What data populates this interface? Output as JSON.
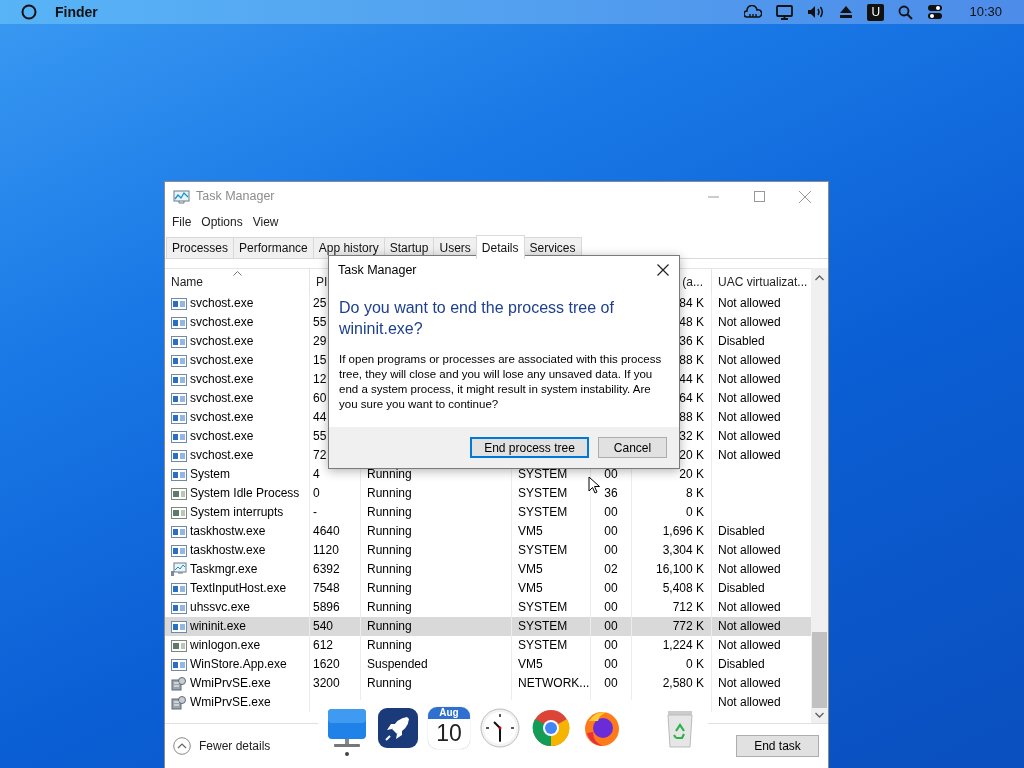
{
  "menubar": {
    "app_name": "Finder",
    "badge_letter": "U",
    "time": "10:30"
  },
  "window": {
    "title": "Task Manager",
    "menu": [
      "File",
      "Options",
      "View"
    ],
    "tabs": [
      {
        "label": "Processes",
        "selected": false
      },
      {
        "label": "Performance",
        "selected": false
      },
      {
        "label": "App history",
        "selected": false
      },
      {
        "label": "Startup",
        "selected": false
      },
      {
        "label": "Users",
        "selected": false
      },
      {
        "label": "Details",
        "selected": true
      },
      {
        "label": "Services",
        "selected": false
      }
    ],
    "table": {
      "columns": {
        "name": "Name",
        "pid": "PI",
        "memory": "(a...",
        "uac": "UAC virtualizat..."
      },
      "rows": [
        {
          "kind": "service",
          "name": "svchost.exe",
          "pid": "25",
          "memory": "84 K",
          "uac": "Not allowed",
          "selected": false
        },
        {
          "kind": "service",
          "name": "svchost.exe",
          "pid": "55",
          "memory": "48 K",
          "uac": "Not allowed",
          "selected": false
        },
        {
          "kind": "service",
          "name": "svchost.exe",
          "pid": "29",
          "memory": "36 K",
          "uac": "Disabled",
          "selected": false
        },
        {
          "kind": "service",
          "name": "svchost.exe",
          "pid": "15",
          "memory": "88 K",
          "uac": "Not allowed",
          "selected": false
        },
        {
          "kind": "service",
          "name": "svchost.exe",
          "pid": "12",
          "memory": "44 K",
          "uac": "Not allowed",
          "selected": false
        },
        {
          "kind": "service",
          "name": "svchost.exe",
          "pid": "60",
          "memory": "64 K",
          "uac": "Not allowed",
          "selected": false
        },
        {
          "kind": "service",
          "name": "svchost.exe",
          "pid": "44",
          "memory": "88 K",
          "uac": "Not allowed",
          "selected": false
        },
        {
          "kind": "service",
          "name": "svchost.exe",
          "pid": "55",
          "memory": "32 K",
          "uac": "Not allowed",
          "selected": false
        },
        {
          "kind": "service",
          "name": "svchost.exe",
          "pid": "72",
          "memory": "20 K",
          "uac": "Not allowed",
          "selected": false
        },
        {
          "kind": "service",
          "name": "System",
          "pid": "4",
          "status": "Running",
          "user": "SYSTEM",
          "cpu": "00",
          "memory": "20 K",
          "selected": false
        },
        {
          "kind": "system",
          "name": "System Idle Process",
          "pid": "0",
          "status": "Running",
          "user": "SYSTEM",
          "cpu": "36",
          "memory": "8 K",
          "selected": false
        },
        {
          "kind": "system",
          "name": "System interrupts",
          "pid": "-",
          "status": "Running",
          "user": "SYSTEM",
          "cpu": "00",
          "memory": "0 K",
          "selected": false
        },
        {
          "kind": "service",
          "name": "taskhostw.exe",
          "pid": "4640",
          "status": "Running",
          "user": "VM5",
          "cpu": "00",
          "memory": "1,696 K",
          "uac": "Disabled",
          "selected": false
        },
        {
          "kind": "service",
          "name": "taskhostw.exe",
          "pid": "1120",
          "status": "Running",
          "user": "SYSTEM",
          "cpu": "00",
          "memory": "3,304 K",
          "uac": "Not allowed",
          "selected": false
        },
        {
          "kind": "taskmgr",
          "name": "Taskmgr.exe",
          "pid": "6392",
          "status": "Running",
          "user": "VM5",
          "cpu": "02",
          "memory": "16,100 K",
          "uac": "Not allowed",
          "selected": false
        },
        {
          "kind": "service",
          "name": "TextInputHost.exe",
          "pid": "7548",
          "status": "Running",
          "user": "VM5",
          "cpu": "00",
          "memory": "5,408 K",
          "uac": "Disabled",
          "selected": false
        },
        {
          "kind": "service",
          "name": "uhssvc.exe",
          "pid": "5896",
          "status": "Running",
          "user": "SYSTEM",
          "cpu": "00",
          "memory": "712 K",
          "uac": "Not allowed",
          "selected": false
        },
        {
          "kind": "service",
          "name": "wininit.exe",
          "pid": "540",
          "status": "Running",
          "user": "SYSTEM",
          "cpu": "00",
          "memory": "772 K",
          "uac": "Not allowed",
          "selected": true
        },
        {
          "kind": "system",
          "name": "winlogon.exe",
          "pid": "612",
          "status": "Running",
          "user": "SYSTEM",
          "cpu": "00",
          "memory": "1,224 K",
          "uac": "Not allowed",
          "selected": false
        },
        {
          "kind": "service",
          "name": "WinStore.App.exe",
          "pid": "1620",
          "status": "Suspended",
          "user": "VM5",
          "cpu": "00",
          "memory": "0 K",
          "uac": "Disabled",
          "selected": false
        },
        {
          "kind": "wmi",
          "name": "WmiPrvSE.exe",
          "pid": "3200",
          "status": "Running",
          "user": "NETWORK...",
          "cpu": "00",
          "memory": "2,580 K",
          "uac": "Not allowed",
          "selected": false
        },
        {
          "kind": "wmi",
          "name": "WmiPrvSE.exe",
          "uac": "Not allowed",
          "selected": false
        }
      ]
    },
    "fewer_details": "Fewer details",
    "end_task": "End task"
  },
  "dialog": {
    "title": "Task Manager",
    "heading": "Do you want to end the process tree of wininit.exe?",
    "message": "If open programs or processes are associated with this process tree, they will close and you will lose any unsaved data. If you end a system process, it might result in system instability. Are you sure you want to continue?",
    "buttons": [
      {
        "label": "End process tree",
        "default": true
      },
      {
        "label": "Cancel",
        "default": false
      }
    ]
  },
  "dock": {
    "items": [
      {
        "kind": "finder",
        "running": true
      },
      {
        "kind": "rocket",
        "running": false
      },
      {
        "kind": "calendar",
        "month": "Aug",
        "day": "10",
        "running": false
      },
      {
        "kind": "clock",
        "running": false
      },
      {
        "kind": "chrome",
        "running": false
      },
      {
        "kind": "firefox",
        "running": false
      },
      {
        "kind": "trash",
        "running": false
      }
    ]
  }
}
